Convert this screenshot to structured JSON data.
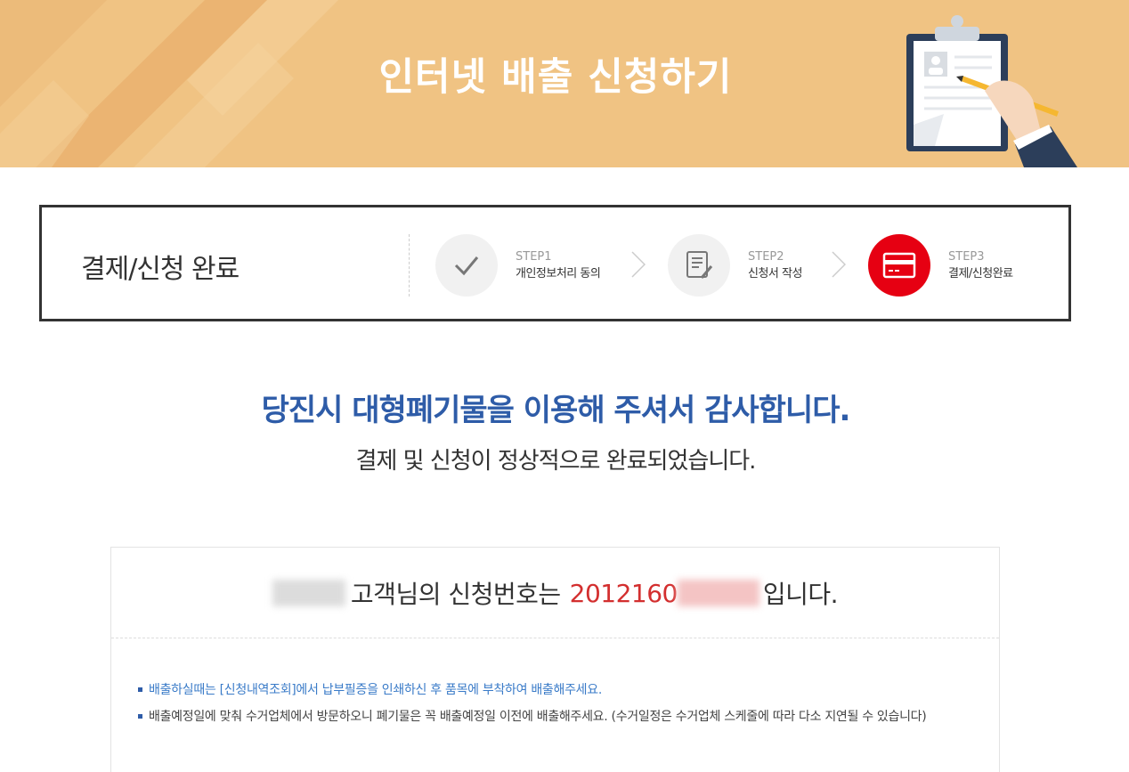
{
  "banner": {
    "title": "인터넷 배출 신청하기"
  },
  "stepbar": {
    "title": "결제/신청 완료",
    "steps": [
      {
        "num": "STEP1",
        "label": "개인정보처리 동의",
        "icon": "check-icon",
        "active": false
      },
      {
        "num": "STEP2",
        "label": "신청서 작성",
        "icon": "document-edit-icon",
        "active": false
      },
      {
        "num": "STEP3",
        "label": "결제/신청완료",
        "icon": "credit-card-icon",
        "active": true
      }
    ]
  },
  "message": {
    "thanks": "당진시 대형폐기물을 이용해 주셔서 감사합니다.",
    "sub": "결제 및 신청이 정상적으로 완료되었습니다."
  },
  "result": {
    "customer_suffix": "고객님의 신청번호는",
    "number_visible": "2012160",
    "ending": "입니다.",
    "notices": [
      "배출하실때는 [신청내역조회]에서 납부필증을 인쇄하신 후 품목에 부착하여 배출해주세요.",
      "배출예정일에 맞춰 수거업체에서 방문하오니 폐기물은 꼭 배출예정일 이전에 배출해주세요. (수거일정은 수거업체 스케줄에 따라 다소 지연될 수 있습니다)"
    ]
  },
  "colors": {
    "banner_bg": "#f0c383",
    "accent_blue": "#2e5ca8",
    "accent_red": "#e60012",
    "number_red": "#d32f2f"
  }
}
